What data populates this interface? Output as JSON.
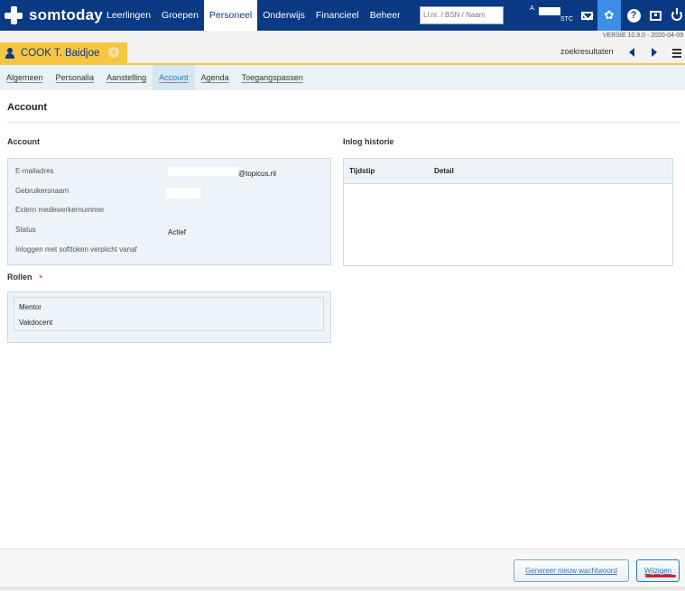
{
  "app": {
    "name": "somtoday",
    "version": "VERSIE 10.9.0 - 2020-04-09"
  },
  "nav": {
    "items": [
      "Leerlingen",
      "Groepen",
      "Personeel",
      "Onderwijs",
      "Financieel",
      "Beheer"
    ],
    "active": "Personeel",
    "search_placeholder": "Ll.nr. / BSN / Naam"
  },
  "user": {
    "initial": "A.",
    "org": "STC"
  },
  "person_tab": {
    "name": "COOK T. Baidjoe"
  },
  "toolbar": {
    "zoek_label": "zoekresultaten"
  },
  "tabs": [
    "Algemeen",
    "Personalia",
    "Aanstelling",
    "Account",
    "Agenda",
    "Toegangspassen"
  ],
  "active_tab": "Account",
  "page_title": "Account",
  "account": {
    "heading": "Account",
    "email_label": "E-mailadres",
    "email_domain": "@topicus.nl",
    "username_label": "Gebruikersnaam",
    "extern_label": "Extern medewerkernummer",
    "status_label": "Status",
    "status_value": "Actief",
    "softtoken_label": "Inloggen met softtoken verplicht vanaf"
  },
  "history": {
    "heading": "Inlog historie",
    "col_time": "Tijdstip",
    "col_detail": "Detail"
  },
  "roles": {
    "heading": "Rollen",
    "required_mark": "*",
    "items": [
      "Mentor",
      "Vakdocent"
    ]
  },
  "buttons": {
    "generate": "Genereer nieuw wachtwoord",
    "edit": "Wijzigen"
  },
  "colors": {
    "navy": "#0a3a84",
    "accent_yellow": "#f6c642",
    "link_blue": "#2f78b6",
    "annotation_red": "#e21f1f"
  }
}
